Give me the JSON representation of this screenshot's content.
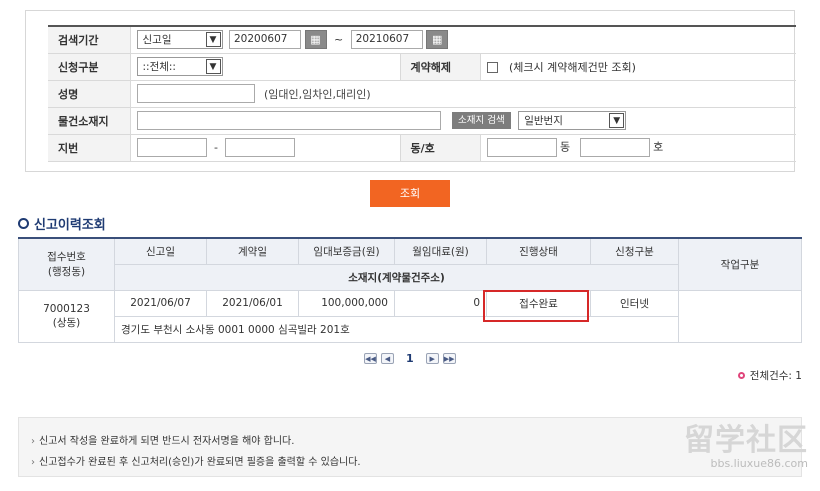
{
  "search": {
    "period_label": "검색기간",
    "period_type": "신고일",
    "date_from": "20200607",
    "date_to": "20210607",
    "tilde": "~",
    "apply_type_label": "신청구분",
    "apply_type_value": "::전체::",
    "cancel_label": "계약해제",
    "cancel_hint": "(체크시 계약해제건만 조회)",
    "name_label": "성명",
    "name_value": "",
    "name_hint": "(임대인,임차인,대리인)",
    "address_label": "물건소재지",
    "address_value": "",
    "address_search_btn": "소재지 검색",
    "address_type": "일반번지",
    "lot_label": "지번",
    "lot_dash": "-",
    "dong_ho_label": "동/호",
    "dong_suffix": "동",
    "ho_suffix": "호",
    "submit": "조회"
  },
  "section_title": "신고이력조회",
  "table": {
    "headers": {
      "receipt_no": "접수번호",
      "receipt_no_sub": "(행정동)",
      "report_date": "신고일",
      "contract_date": "계약일",
      "deposit": "임대보증금(원)",
      "monthly_rent": "월임대료(원)",
      "status": "진행상태",
      "apply_type": "신청구분",
      "work_type": "작업구분",
      "location": "소재지(계약물건주소)"
    },
    "rows": [
      {
        "receipt_no": "7000123",
        "admin_dong": "(상동)",
        "report_date": "2021/06/07",
        "contract_date": "2021/06/01",
        "deposit": "100,000,000",
        "monthly_rent": "0",
        "status": "접수완료",
        "apply_type": "인터넷",
        "work_type": "",
        "address": "경기도 부천시 소사동 0001 0000 심곡빌라 201호"
      }
    ]
  },
  "pager": {
    "first": "◀◀",
    "prev": "◀",
    "current": "1",
    "next": "▶",
    "last": "▶▶"
  },
  "total_count": "전체건수: 1",
  "notices": [
    "신고서 작성을 완료하게 되면 반드시 전자서명을 해야 합니다.",
    "신고접수가 완료된 후 신고처리(승인)가 완료되면 필증을 출력할 수 있습니다."
  ],
  "watermark": {
    "main": "留学社区",
    "sub": "bbs.liuxue86.com"
  },
  "colors": {
    "accent": "#f26522",
    "title": "#1f3b73",
    "highlight": "#d62828"
  }
}
